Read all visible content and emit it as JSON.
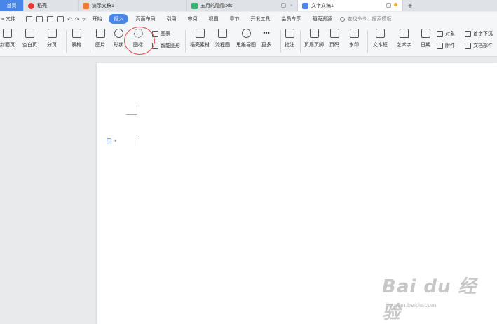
{
  "tabs": [
    {
      "label": "首页",
      "kind": "home"
    },
    {
      "label": "稻壳",
      "icon_color": "#e53935"
    },
    {
      "label": "演示文稿1",
      "icon_color": "#f07a3c"
    },
    {
      "label": "五月的隐隐.xls",
      "icon_color": "#3bb273"
    },
    {
      "label": "文字文稿1",
      "icon_color": "#4a86e8",
      "active": true
    }
  ],
  "menu": {
    "file": "文件",
    "items": [
      "开始",
      "插入",
      "页面布局",
      "引用",
      "审阅",
      "视图",
      "章节",
      "开发工具",
      "会员专享",
      "稻壳资源"
    ],
    "active": "插入",
    "search_placeholder": "查找命令、搜索模板"
  },
  "ribbon": {
    "big_buttons": [
      {
        "label": "封面页",
        "icon": "cover-page-icon"
      },
      {
        "label": "空白页",
        "icon": "blank-page-icon"
      },
      {
        "label": "分页",
        "icon": "page-break-icon"
      },
      {
        "label": "表格",
        "icon": "table-icon"
      },
      {
        "label": "图片",
        "icon": "picture-icon"
      },
      {
        "label": "形状",
        "icon": "shape-icon"
      },
      {
        "label": "图标",
        "icon": "icons-icon"
      },
      {
        "label": "稻壳素材",
        "icon": "material-icon"
      },
      {
        "label": "流程图",
        "icon": "flowchart-icon"
      },
      {
        "label": "思维导图",
        "icon": "mindmap-icon"
      },
      {
        "label": "更多",
        "icon": "more-icon"
      },
      {
        "label": "批注",
        "icon": "comment-icon"
      },
      {
        "label": "页眉页脚",
        "icon": "header-footer-icon"
      },
      {
        "label": "页码",
        "icon": "page-number-icon"
      },
      {
        "label": "水印",
        "icon": "watermark-icon"
      },
      {
        "label": "文本框",
        "icon": "textbox-icon"
      },
      {
        "label": "艺术字",
        "icon": "wordart-icon"
      },
      {
        "label": "日期",
        "icon": "date-icon"
      }
    ],
    "small_buttons": [
      {
        "label": "图表",
        "icon": "chart-icon"
      },
      {
        "label": "智能图形",
        "icon": "smartart-icon"
      },
      {
        "label": "对象",
        "icon": "object-icon"
      },
      {
        "label": "附件",
        "icon": "attachment-icon"
      },
      {
        "label": "首字下沉",
        "icon": "drop-cap-icon"
      },
      {
        "label": "文档部件",
        "icon": "doc-parts-icon"
      }
    ]
  },
  "watermark": {
    "logo": "Bai du 经验",
    "url": "jingyan.baidu.com"
  },
  "colors": {
    "accent": "#4a86e8",
    "highlight_circle": "#e04a4a"
  }
}
